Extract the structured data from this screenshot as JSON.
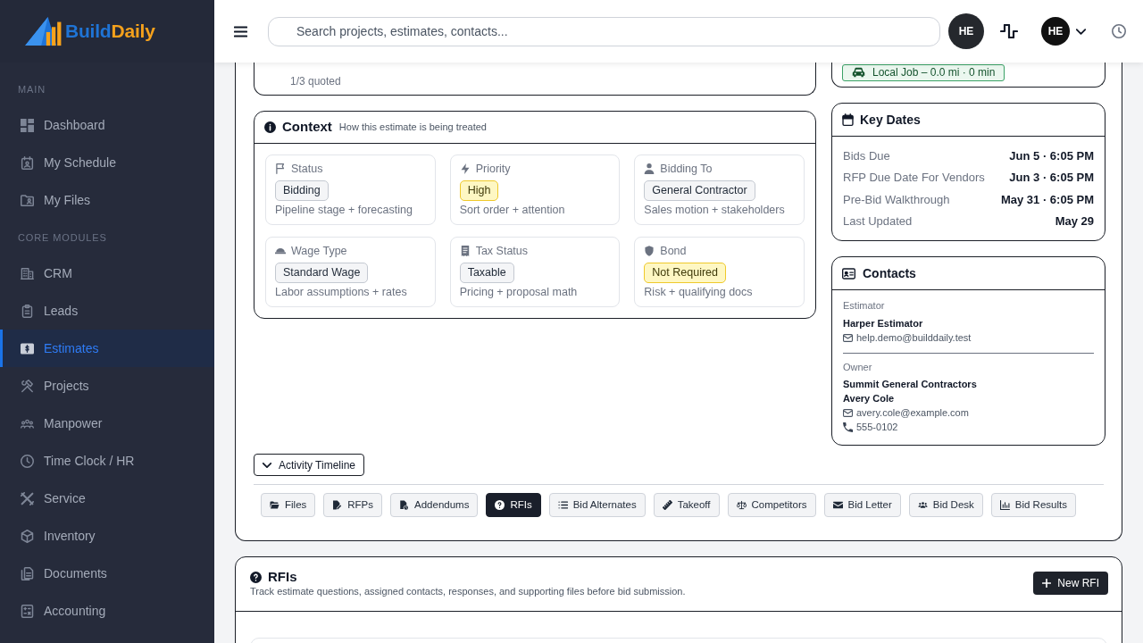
{
  "sidebar": {
    "logo": {
      "text_1": "Build",
      "text_2": "Daily"
    },
    "sections": [
      {
        "title": "MAIN",
        "items": [
          {
            "label": "Dashboard",
            "selected": false
          },
          {
            "label": "My Schedule",
            "selected": false
          },
          {
            "label": "My Files",
            "selected": false
          }
        ]
      },
      {
        "title": "CORE MODULES",
        "items": [
          {
            "label": "CRM",
            "selected": false
          },
          {
            "label": "Leads",
            "selected": false
          },
          {
            "label": "Estimates",
            "selected": true
          },
          {
            "label": "Projects",
            "selected": false
          },
          {
            "label": "Manpower",
            "selected": false
          },
          {
            "label": "Time Clock / HR",
            "selected": false
          },
          {
            "label": "Service",
            "selected": false
          },
          {
            "label": "Inventory",
            "selected": false
          },
          {
            "label": "Documents",
            "selected": false
          },
          {
            "label": "Accounting",
            "selected": false
          }
        ]
      }
    ]
  },
  "header": {
    "search": {
      "placeholder": "Search projects, estimates, contacts..."
    },
    "avatar": "HE",
    "user_menu": {
      "initials": "HE"
    }
  },
  "quote_summary": {
    "text": "1/3 quoted"
  },
  "travel": {
    "badge": "Local Job – 0.0 mi · 0 min"
  },
  "context": {
    "title": "Context",
    "subtitle": "How this estimate is being treated",
    "fields": [
      {
        "label": "Status",
        "value": "Bidding",
        "description": "Pipeline stage + forecasting",
        "highlighted": false
      },
      {
        "label": "Priority",
        "value": "High",
        "description": "Sort order + attention",
        "highlighted": true
      },
      {
        "label": "Bidding To",
        "value": "General Contractor",
        "description": "Sales motion + stakeholders",
        "highlighted": false
      },
      {
        "label": "Wage Type",
        "value": "Standard Wage",
        "description": "Labor assumptions + rates",
        "highlighted": false
      },
      {
        "label": "Tax Status",
        "value": "Taxable",
        "description": "Pricing + proposal math",
        "highlighted": false
      },
      {
        "label": "Bond",
        "value": "Not Required",
        "description": "Risk + qualifying docs",
        "highlighted": true
      }
    ]
  },
  "key_dates": {
    "title": "Key Dates",
    "rows": [
      {
        "label": "Bids Due",
        "value": "Jun 5 · 6:05 PM"
      },
      {
        "label": "RFP Due Date For Vendors",
        "value": "Jun 3 · 6:05 PM"
      },
      {
        "label": "Pre-Bid Walkthrough",
        "value": "May 31 · 6:05 PM"
      },
      {
        "label": "Last Updated",
        "value": "May 29"
      }
    ]
  },
  "contacts": {
    "title": "Contacts",
    "groups": [
      {
        "role": "Estimator",
        "name": "Harper Estimator",
        "email": "help.demo@builddaily.test"
      },
      {
        "role": "Owner",
        "company": "Summit General Contractors",
        "name": "Avery Cole",
        "email": "avery.cole@example.com",
        "phone": "555-0102"
      }
    ]
  },
  "activity_timeline": {
    "label": "Activity Timeline",
    "expanded": false
  },
  "tabs": [
    {
      "label": "Files",
      "selected": false
    },
    {
      "label": "RFPs",
      "selected": false
    },
    {
      "label": "Addendums",
      "selected": false
    },
    {
      "label": "RFIs",
      "selected": true
    },
    {
      "label": "Bid Alternates",
      "selected": false
    },
    {
      "label": "Takeoff",
      "selected": false
    },
    {
      "label": "Competitors",
      "selected": false
    },
    {
      "label": "Bid Letter",
      "selected": false
    },
    {
      "label": "Bid Desk",
      "selected": false
    },
    {
      "label": "Bid Results",
      "selected": false
    }
  ],
  "rfis": {
    "title": "RFIs",
    "subtitle": "Track estimate questions, assigned contacts, responses, and supporting files before bid submission.",
    "button": "New RFI"
  }
}
